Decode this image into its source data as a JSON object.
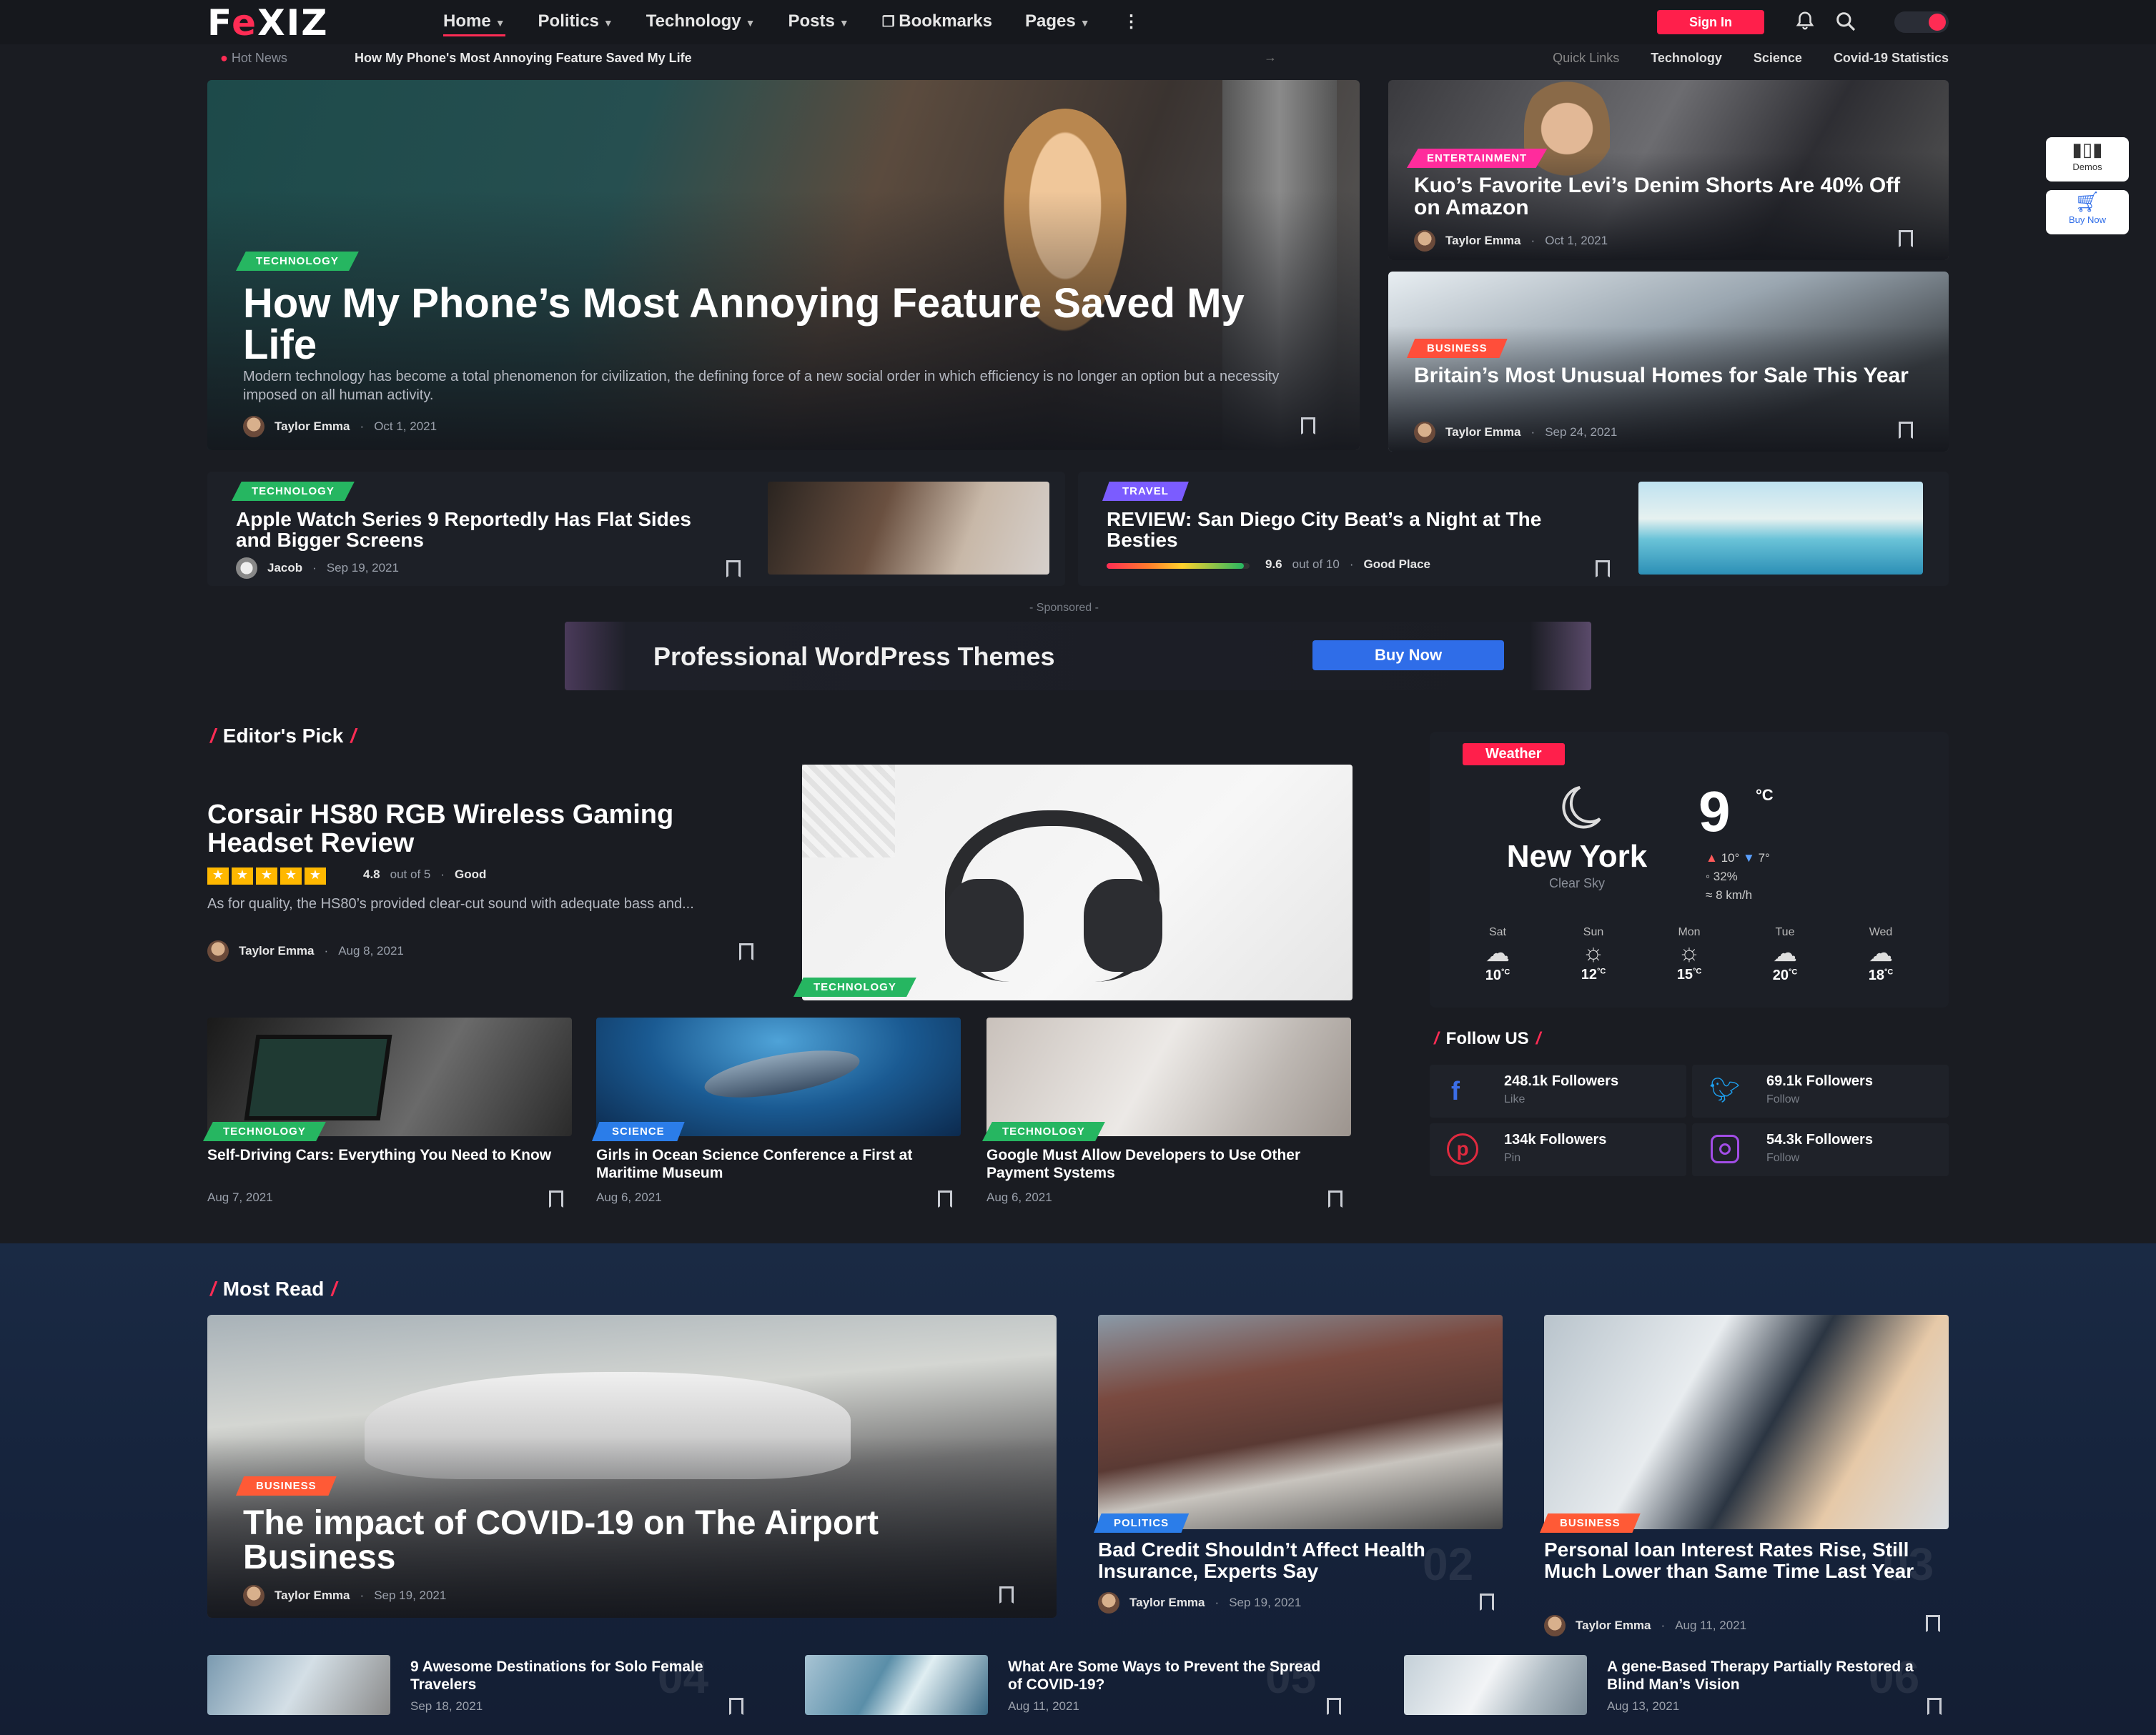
{
  "header": {
    "logo_left": "F",
    "logo_e": "e",
    "logo_right": "XIZ",
    "nav": [
      "Home",
      "Politics",
      "Technology",
      "Posts",
      "Bookmarks",
      "Pages"
    ],
    "signin": "Sign In",
    "more": "⋮"
  },
  "hotbar": {
    "label": "Hot News",
    "title": "How My Phone's Most Annoying Feature Saved My Life",
    "quicklinks_label": "Quick Links",
    "quicklinks": [
      "Technology",
      "Science",
      "Covid-19 Statistics"
    ]
  },
  "hero": {
    "tag": "TECHNOLOGY",
    "title": "How My Phone’s Most Annoying Feature Saved My Life",
    "excerpt": "Modern technology has become a total phenomenon for civilization, the defining force of a new social order in which efficiency is no longer an option but a necessity imposed on all human activity.",
    "author": "Taylor Emma",
    "date": "Oct 1, 2021"
  },
  "side1": {
    "tag": "ENTERTAINMENT",
    "title": "Kuo’s Favorite Levi’s Denim Shorts Are 40% Off on Amazon",
    "author": "Taylor Emma",
    "date": "Oct 1, 2021"
  },
  "side2": {
    "tag": "BUSINESS",
    "title": "Britain’s Most Unusual Homes for Sale This Year",
    "author": "Taylor Emma",
    "date": "Sep 24, 2021"
  },
  "row1a": {
    "tag": "TECHNOLOGY",
    "title": "Apple Watch Series 9 Reportedly Has Flat Sides and Bigger Screens",
    "author": "Jacob",
    "date": "Sep 19, 2021"
  },
  "row1b": {
    "tag": "TRAVEL",
    "title": "REVIEW: San Diego City Beat’s a Night at The Besties",
    "score": "9.6",
    "score_of": "out of 10",
    "verdict": "Good Place",
    "rating_fraction": 0.96
  },
  "ad": {
    "sponsored": "- Sponsored -",
    "text": "Professional WordPress Themes",
    "button": "Buy Now"
  },
  "editors": {
    "title": "Editor's Pick",
    "feature": {
      "title": "Corsair HS80 RGB Wireless Gaming Headset Review",
      "rating": "4.8",
      "rating_of": "out of 5",
      "verdict": "Good",
      "stars": 5,
      "excerpt": "As for quality, the HS80’s provided clear-cut sound with adequate bass and...",
      "author": "Taylor Emma",
      "date": "Aug 8, 2021",
      "tag": "TECHNOLOGY"
    },
    "cards": [
      {
        "tag": "TECHNOLOGY",
        "title": "Self-Driving Cars: Everything You Need to Know",
        "date": "Aug 7, 2021"
      },
      {
        "tag": "SCIENCE",
        "title": "Girls in Ocean Science Conference a First at Maritime Museum",
        "date": "Aug 6, 2021"
      },
      {
        "tag": "TECHNOLOGY",
        "title": "Google Must Allow Developers to Use Other Payment Systems",
        "date": "Aug 6, 2021"
      }
    ]
  },
  "weather": {
    "label": "Weather",
    "city": "New York",
    "desc": "Clear Sky",
    "temp": "9",
    "unit": "°C",
    "hi": "10°",
    "lo": "7°",
    "humidity": "32%",
    "wind": "8 km/h",
    "days": [
      {
        "d": "Sat",
        "t": "10",
        "icon": "cloud-icon"
      },
      {
        "d": "Sun",
        "t": "12",
        "icon": "sun-icon"
      },
      {
        "d": "Mon",
        "t": "15",
        "icon": "sun-icon"
      },
      {
        "d": "Tue",
        "t": "20",
        "icon": "cloud-icon"
      },
      {
        "d": "Wed",
        "t": "18",
        "icon": "cloud-icon"
      }
    ],
    "deg": "°C"
  },
  "follow": {
    "title": "Follow US",
    "items": [
      {
        "count": "248.1k Followers",
        "action": "Like",
        "icon": "facebook-icon",
        "color": "#3b6de6"
      },
      {
        "count": "69.1k Followers",
        "action": "Follow",
        "icon": "twitter-icon",
        "color": "#1da1f2"
      },
      {
        "count": "134k Followers",
        "action": "Pin",
        "icon": "pinterest-icon",
        "color": "#e02a3f"
      },
      {
        "count": "54.3k Followers",
        "action": "Follow",
        "icon": "instagram-icon",
        "color": "#a24de6"
      }
    ]
  },
  "mostread": {
    "title": "Most Read",
    "big": {
      "tag": "BUSINESS",
      "title": "The impact of COVID-19 on The Airport Business",
      "author": "Taylor Emma",
      "date": "Sep 19, 2021"
    },
    "m2": {
      "tag": "POLITICS",
      "title": "Bad Credit Shouldn’t Affect Health Insurance, Experts Say",
      "author": "Taylor Emma",
      "date": "Sep 19, 2021",
      "num": "02"
    },
    "m3": {
      "tag": "BUSINESS",
      "title": "Personal loan Interest Rates Rise, Still Much Lower than Same Time Last Year",
      "author": "Taylor Emma",
      "date": "Aug 11, 2021",
      "num": "03"
    },
    "small": [
      {
        "title": "9 Awesome Destinations for Solo Female Travelers",
        "date": "Sep 18, 2021",
        "num": "04"
      },
      {
        "title": "What Are Some Ways to Prevent the Spread of COVID-19?",
        "date": "Aug 11, 2021",
        "num": "05"
      },
      {
        "title": "A gene-Based Therapy Partially Restored a Blind Man’s Vision",
        "date": "Aug 13, 2021",
        "num": "06"
      }
    ]
  },
  "floating": {
    "demos": "Demos",
    "buy": "Buy Now"
  }
}
